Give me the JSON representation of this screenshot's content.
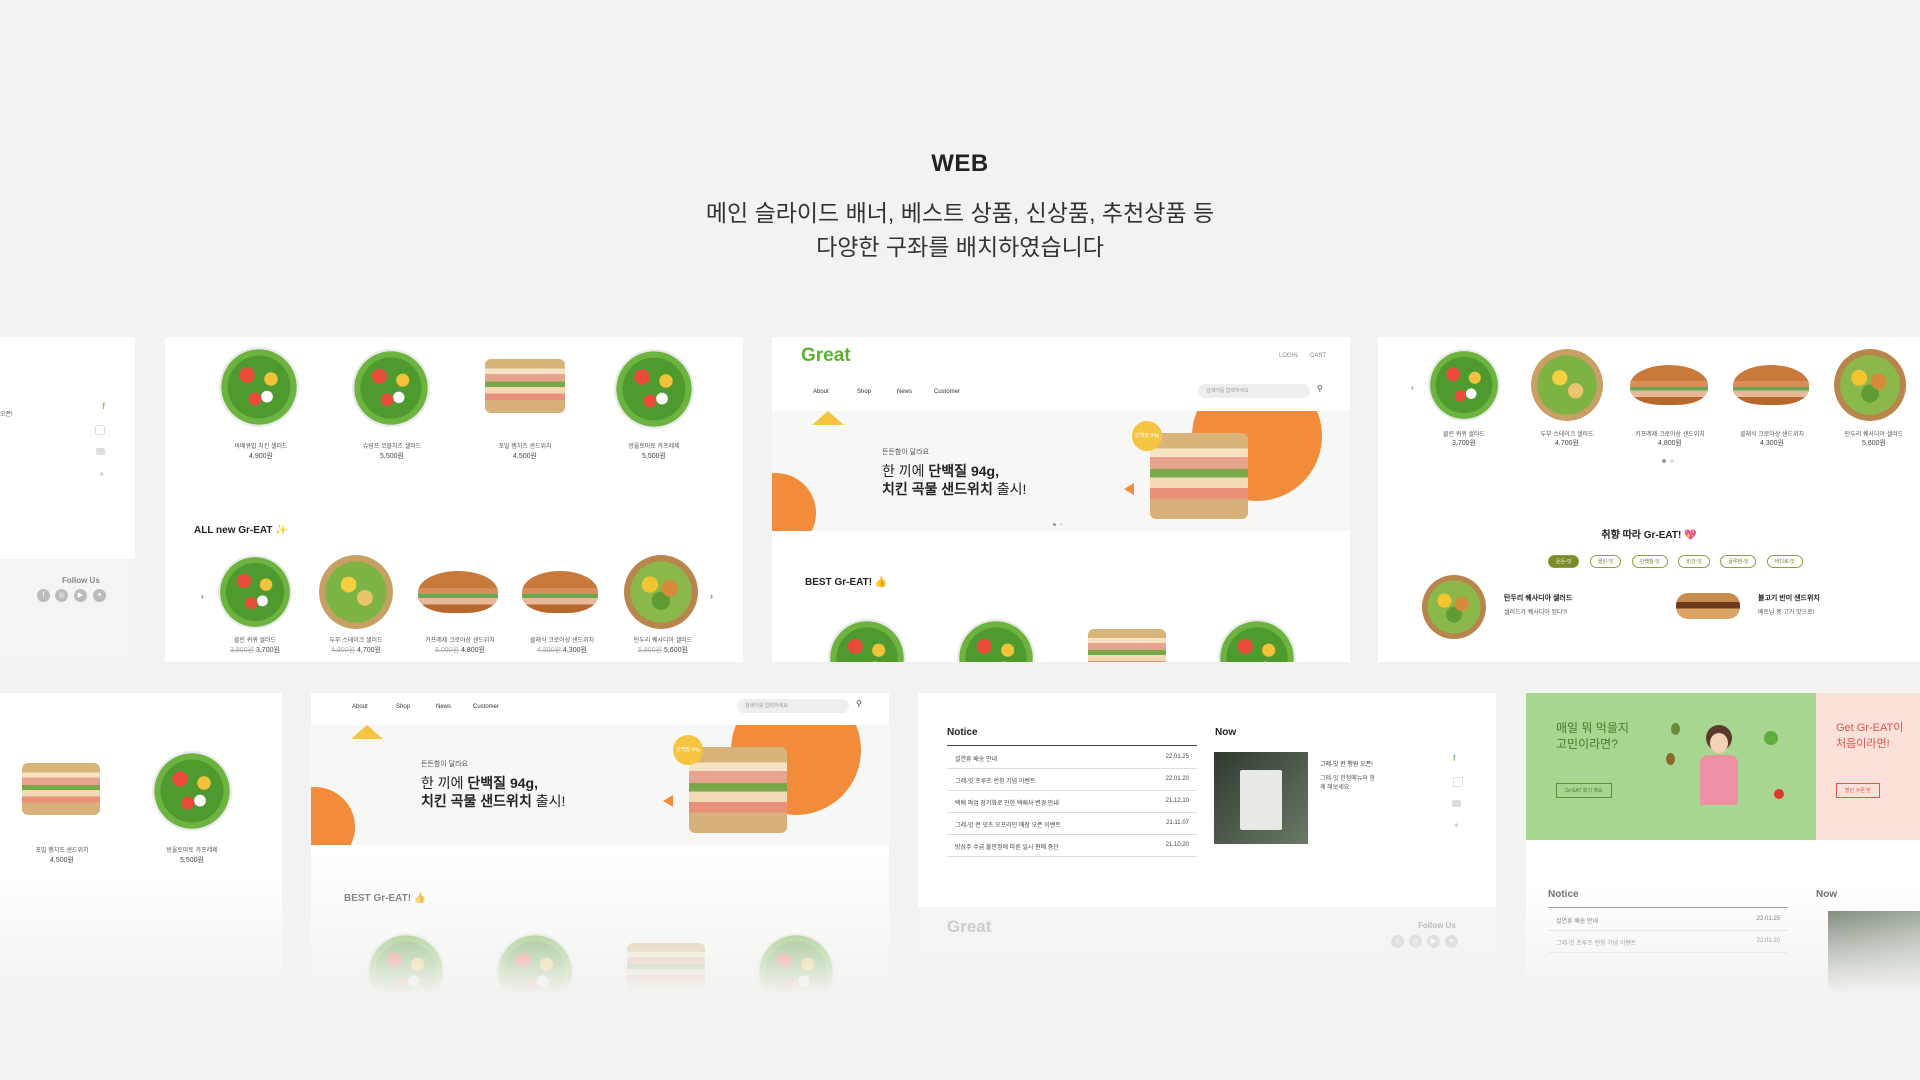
{
  "header": {
    "title": "WEB",
    "desc_line1": "메인 슬라이드 배너, 베스트 상품, 신상품, 추천상품 등",
    "desc_line2": "다양한 구좌를 배치하였습니다"
  },
  "colors": {
    "brand_green": "#5db12f",
    "accent_orange": "#f28c3b",
    "yellow": "#f5c542",
    "bg": "#f2f2f0"
  },
  "brand": {
    "logo": "Great"
  },
  "nav": {
    "about": "About",
    "shop": "Shop",
    "news": "News",
    "customer": "Customer",
    "login": "LOGIN",
    "cart": "CART",
    "search_placeholder": "검색어를 입력하세요"
  },
  "banner": {
    "kicker": "든든함이 달라요",
    "line1_pre": "한 끼에 ",
    "line1_bold": "단백질 94g,",
    "line2_bold": "치킨 곡물 샌드위치",
    "line2_post": " 출시!",
    "badge": "단백질 94g"
  },
  "sections": {
    "all_new": "ALL new Gr-EAT ✨",
    "best": "BEST Gr-EAT! 👍",
    "taste": "취향 따라 Gr-EAT! 💖",
    "notice": "Notice",
    "now": "Now",
    "follow": "Follow Us"
  },
  "best_products": [
    {
      "name": "바베큐밥 치킨 샐러드",
      "price": "4,900원"
    },
    {
      "name": "슈림프 코블치즈 샐러드",
      "price": "5,500원"
    },
    {
      "name": "포밀 햄치즈 샌드위치",
      "price": "4,500원"
    },
    {
      "name": "방울토마토 카프레제",
      "price": "5,500원"
    }
  ],
  "new_products": [
    {
      "name": "클린 퀴퀴 샐러드",
      "old": "3,900원",
      "price": "3,700원"
    },
    {
      "name": "두부 스테이크 샐러드",
      "old": "4,900원",
      "price": "4,700원"
    },
    {
      "name": "카프레제 크로아상 샌드위치",
      "old": "5,000원",
      "price": "4,800원"
    },
    {
      "name": "클래식 크로아상 샌드위치",
      "old": "4,500원",
      "price": "4,300원"
    },
    {
      "name": "탄두리 퀘사디아 샐러드",
      "old": "5,800원",
      "price": "5,600원"
    }
  ],
  "taste_pills": [
    "든든-잇",
    "클린-잇",
    "단백질-잇",
    "비건-잇",
    "글루텐-잇",
    "바디로-잇"
  ],
  "taste_items": [
    {
      "name": "탄두리 퀘사디아 샐러드",
      "desc": "샐러드가 퀘사디아 된다?!"
    },
    {
      "name": "불고기 반미 샌드위치",
      "desc": "베트남 풍 고기 맛으로!"
    }
  ],
  "notices": [
    {
      "title": "설연휴 배송 안내",
      "date": "22.01.25"
    },
    {
      "title": "그레-잇 프루츠 런칭 기념 이벤트",
      "date": "22.01.20"
    },
    {
      "title": "택배 파업 장기화로 인한 택배사 변경 안내",
      "date": "21.12.10"
    },
    {
      "title": "그레-잇 런 잇츠 오프라인 매장 오픈 이벤트",
      "date": "21.11.07"
    },
    {
      "title": "방상주 수급 불안정에 따른 일시 판매 중단",
      "date": "21.10.20"
    }
  ],
  "now_item": {
    "title": "그레-잇 런 행원 오픈!",
    "desc": "그레-잇 한정메뉴와 함께 해보세요"
  },
  "promo": {
    "line1": "매일 뭐 먹을지",
    "line2": "고민이라면?",
    "button": "Gr-EAT 회기 예요",
    "right1": "Get Gr-EAT이",
    "right2": "처음이라면!",
    "right_button": "할인 쿠폰 받"
  }
}
